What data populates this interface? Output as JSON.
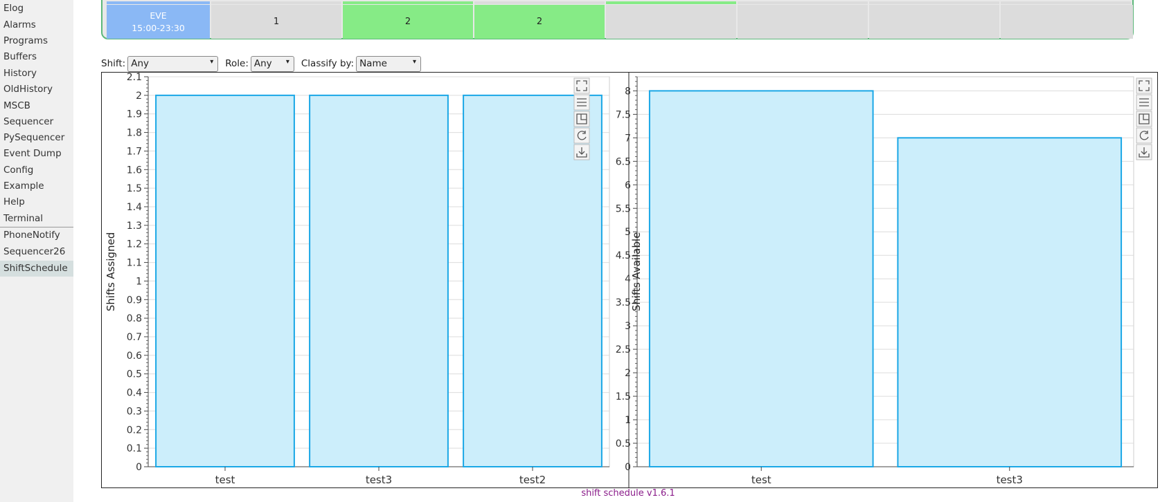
{
  "sidebar": {
    "items": [
      {
        "label": "Elog"
      },
      {
        "label": "Alarms"
      },
      {
        "label": "Programs"
      },
      {
        "label": "Buffers"
      },
      {
        "label": "History"
      },
      {
        "label": "OldHistory"
      },
      {
        "label": "MSCB"
      },
      {
        "label": "Sequencer"
      },
      {
        "label": "PySequencer"
      },
      {
        "label": "Event Dump"
      },
      {
        "label": "Config"
      },
      {
        "label": "Example"
      },
      {
        "label": "Help"
      },
      {
        "label": "Terminal"
      },
      {
        "label": "PhoneNotify"
      },
      {
        "label": "Sequencer26"
      },
      {
        "label": "ShiftSchedule"
      }
    ],
    "active": "ShiftSchedule"
  },
  "schedule": {
    "shift_name": "EVE",
    "shift_time": "15:00-23:30",
    "cells": [
      "1",
      "2",
      "2",
      "",
      "",
      "",
      ""
    ],
    "cell_states": [
      "grey",
      "green",
      "green",
      "grey",
      "grey",
      "grey",
      "grey"
    ],
    "top_strip_states": [
      "grey",
      "green",
      "grey",
      "green",
      "grey",
      "grey",
      "grey"
    ],
    "colors": {
      "label": "#8ab8f5",
      "green": "#86eb86",
      "grey": "#dcdcdc",
      "border": "#5cb87a"
    }
  },
  "filters": {
    "shift_label": "Shift:",
    "shift_value": "Any",
    "role_label": "Role:",
    "role_value": "Any",
    "classify_label": "Classify by:",
    "classify_value": "Name"
  },
  "toolbar_icons": [
    "fullscreen-icon",
    "menu-icon",
    "popout-icon",
    "reset-icon",
    "download-icon"
  ],
  "chart_data": [
    {
      "type": "bar",
      "ylabel": "Shifts Assigned",
      "categories": [
        "test",
        "test3",
        "test2"
      ],
      "values": [
        2,
        2,
        2
      ],
      "ylim": [
        0,
        2.1
      ],
      "ytick_step": 0.1,
      "bar_color": "#cceefb",
      "bar_edge": "#1aa7e6",
      "grid": true
    },
    {
      "type": "bar",
      "ylabel": "Shifts Available",
      "categories": [
        "test",
        "test3"
      ],
      "values": [
        8,
        7
      ],
      "ylim": [
        0,
        8.3
      ],
      "ytick_step": 0.5,
      "bar_color": "#cceefb",
      "bar_edge": "#1aa7e6",
      "grid": true
    }
  ],
  "footer": {
    "text": "shift schedule v1.6.1"
  }
}
